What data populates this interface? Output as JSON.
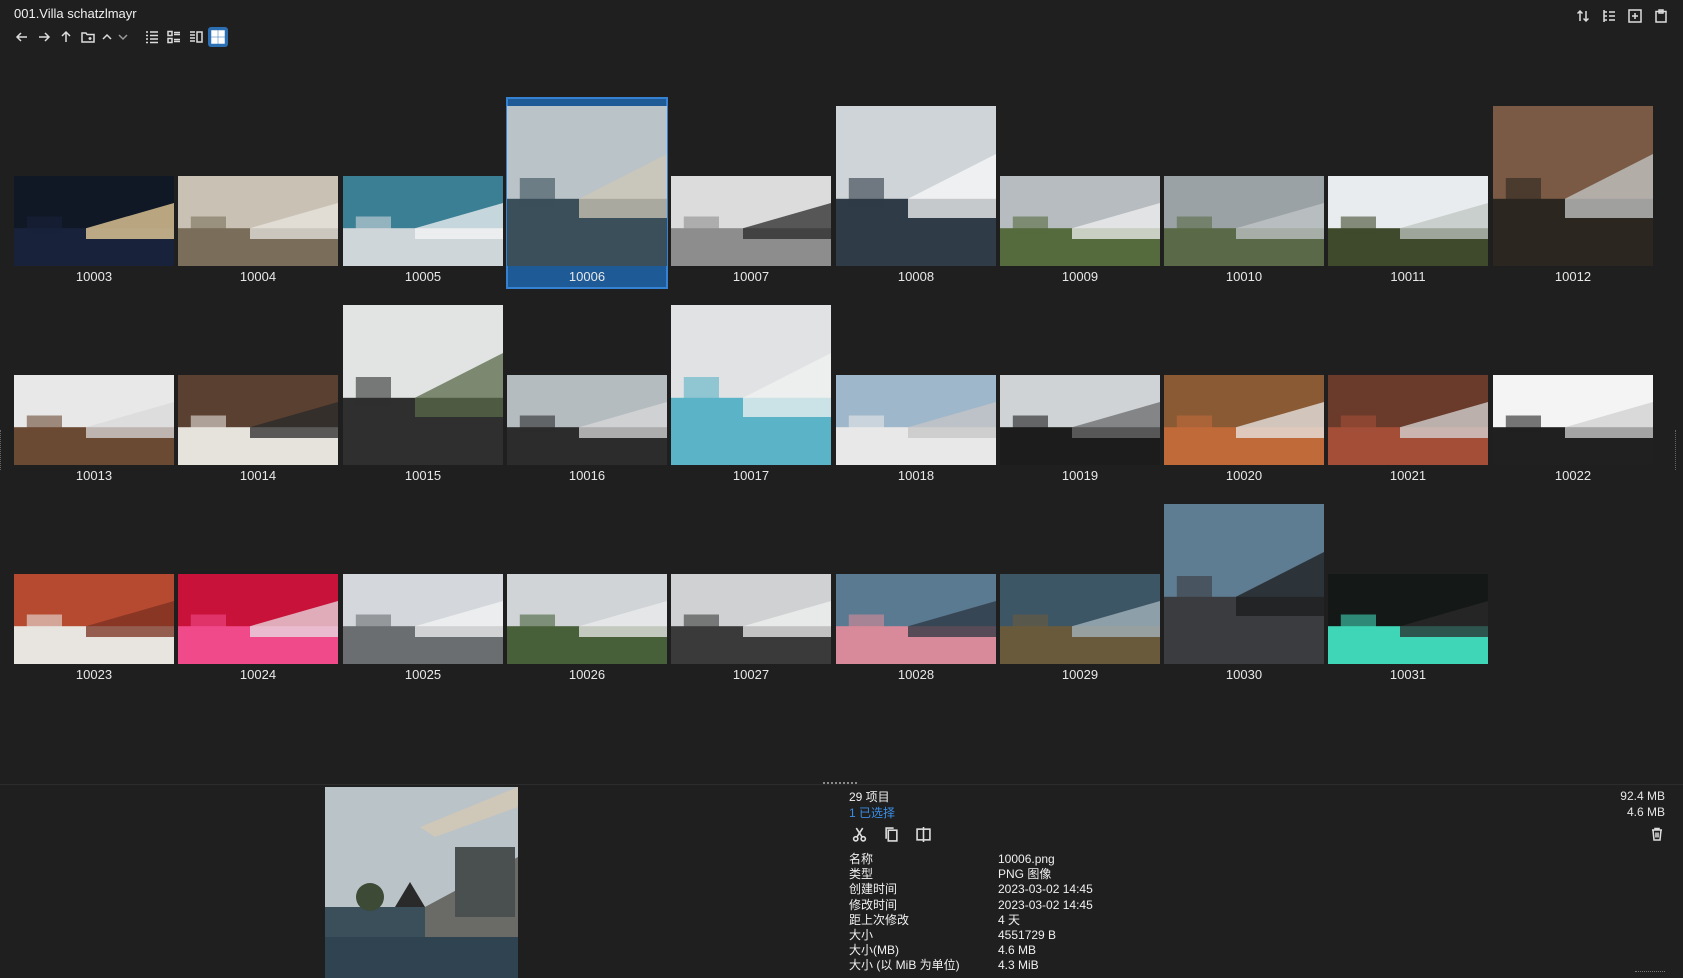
{
  "window": {
    "title": "001.Villa schatzlmayr"
  },
  "toolbar": {
    "icons": [
      "arrow-left-icon",
      "arrow-right-icon",
      "arrow-up-icon",
      "new-folder-icon",
      "chevron-up-icon",
      "chevron-down-icon",
      "list-view-icon",
      "details-view-icon",
      "columns-view-icon",
      "grid-view-icon"
    ],
    "top_right_icons": [
      "sort-icon",
      "tree-view-icon",
      "add-tab-icon",
      "clipboard-icon"
    ],
    "active_view": "grid-view-icon",
    "accent_color": "#2c6fb2"
  },
  "thumbnails": [
    {
      "label": "10003"
    },
    {
      "label": "10004"
    },
    {
      "label": "10005"
    },
    {
      "label": "10006",
      "selected": true
    },
    {
      "label": "10007"
    },
    {
      "label": "10008"
    },
    {
      "label": "10009"
    },
    {
      "label": "10010"
    },
    {
      "label": "10011"
    },
    {
      "label": "10012"
    },
    {
      "label": "10013"
    },
    {
      "label": "10014"
    },
    {
      "label": "10015"
    },
    {
      "label": "10016"
    },
    {
      "label": "10017"
    },
    {
      "label": "10018"
    },
    {
      "label": "10019"
    },
    {
      "label": "10020"
    },
    {
      "label": "10021"
    },
    {
      "label": "10022"
    },
    {
      "label": "10023"
    },
    {
      "label": "10024"
    },
    {
      "label": "10025"
    },
    {
      "label": "10026"
    },
    {
      "label": "10027"
    },
    {
      "label": "10028"
    },
    {
      "label": "10029"
    },
    {
      "label": "10030"
    },
    {
      "label": "10031"
    }
  ],
  "details": {
    "item_count": "29 项目",
    "selected_count": "1 已选择",
    "total_size": "92.4 MB",
    "selected_size": "4.6 MB",
    "action_icons": [
      "cut-icon",
      "copy-icon",
      "compare-icon"
    ],
    "properties": [
      {
        "key": "名称",
        "value": "10006.png"
      },
      {
        "key": "类型",
        "value": "PNG 图像"
      },
      {
        "key": "创建时间",
        "value": "2023-03-02  14:45"
      },
      {
        "key": "修改时间",
        "value": "2023-03-02  14:45"
      },
      {
        "key": "距上次修改",
        "value": "4 天"
      },
      {
        "key": "大小",
        "value": "4551729 B"
      },
      {
        "key": "大小(MB)",
        "value": "4.6 MB"
      },
      {
        "key": "大小 (以 MiB 为单位)",
        "value": "4.3 MiB"
      }
    ]
  }
}
